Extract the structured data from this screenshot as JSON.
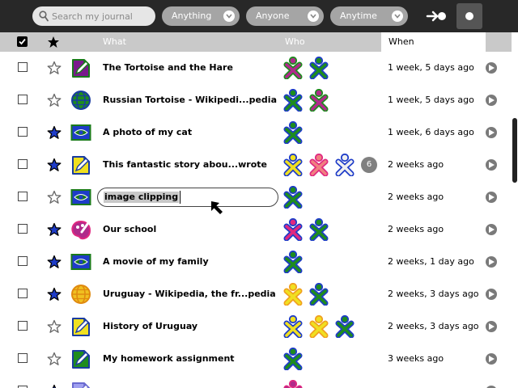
{
  "toolbar": {
    "search_placeholder": "Search my journal",
    "filters": [
      {
        "label": "Anything"
      },
      {
        "label": "Anyone"
      },
      {
        "label": "Anytime"
      }
    ],
    "buttons": [
      "share-arrow-icon",
      "record-icon"
    ]
  },
  "columns": {
    "what": "What",
    "who": "Who",
    "when": "When"
  },
  "entries": [
    {
      "title": "The Tortoise and the Hare",
      "when": "1 week, 5 days ago",
      "starred": false,
      "icon": "write-activity-icon",
      "icon_colors": {
        "stroke": "#1a7a1a",
        "fill": "#7a1a8c"
      },
      "buddies": [
        {
          "stroke": "#1e8c1e",
          "fill": "#b02a8a"
        },
        {
          "stroke": "#1e3cc8",
          "fill": "#1e8c1e"
        }
      ]
    },
    {
      "title": "Russian Tortoise - Wikipedi...pedia",
      "when": "1 week, 5 days ago",
      "starred": false,
      "icon": "browse-activity-icon",
      "icon_colors": {
        "stroke": "#1a3ca0",
        "fill": "#1e8c1e"
      },
      "buddies": [
        {
          "stroke": "#1e3cc8",
          "fill": "#1e8c1e"
        },
        {
          "stroke": "#1e8c1e",
          "fill": "#b02a8a"
        }
      ]
    },
    {
      "title": "A photo of my cat",
      "when": "1 week, 6 days ago",
      "starred": true,
      "icon": "image-viewer-icon",
      "icon_colors": {
        "stroke": "#1a7a1a",
        "fill": "#1e3cc8"
      },
      "buddies": [
        {
          "stroke": "#1e3cc8",
          "fill": "#1e8c1e"
        }
      ]
    },
    {
      "title": "This fantastic story abou...wrote",
      "when": "2 weeks ago",
      "starred": true,
      "icon": "write-activity-icon",
      "icon_colors": {
        "stroke": "#1a3ca0",
        "fill": "#f0e020"
      },
      "buddies": [
        {
          "stroke": "#1e3cc8",
          "fill": "#f0e020"
        },
        {
          "stroke": "#e02880",
          "fill": "#f08080"
        },
        {
          "stroke": "#1e3cc8",
          "fill": "#f0f0f0"
        }
      ],
      "more_buddies": "6"
    },
    {
      "title": "image clipping",
      "when": "2 weeks ago",
      "starred": false,
      "editing": true,
      "icon": "image-viewer-icon",
      "icon_colors": {
        "stroke": "#1a7a1a",
        "fill": "#1e3cc8"
      },
      "buddies": [
        {
          "stroke": "#1e3cc8",
          "fill": "#1e8c1e"
        }
      ]
    },
    {
      "title": "Our school",
      "when": "2 weeks ago",
      "starred": true,
      "icon": "paint-activity-icon",
      "icon_colors": {
        "stroke": "#e02880",
        "fill": "#b02a8a"
      },
      "buddies": [
        {
          "stroke": "#1e3cc8",
          "fill": "#e02880"
        },
        {
          "stroke": "#1e3cc8",
          "fill": "#1e8c1e"
        }
      ]
    },
    {
      "title": "A movie of my family",
      "when": "2 weeks, 1 day ago",
      "starred": true,
      "icon": "image-viewer-icon",
      "icon_colors": {
        "stroke": "#1a7a1a",
        "fill": "#1e3cc8"
      },
      "buddies": [
        {
          "stroke": "#1e3cc8",
          "fill": "#1e8c1e"
        }
      ]
    },
    {
      "title": "Uruguay - Wikipedia, the fr...pedia",
      "when": "2 weeks, 3 days ago",
      "starred": true,
      "icon": "browse-activity-icon",
      "icon_colors": {
        "stroke": "#e08a10",
        "fill": "#f0c020"
      },
      "buddies": [
        {
          "stroke": "#f0a020",
          "fill": "#f0e020"
        },
        {
          "stroke": "#1e3cc8",
          "fill": "#1e8c1e"
        }
      ]
    },
    {
      "title": "History of Uruguay",
      "when": "2 weeks, 3 days ago",
      "starred": false,
      "icon": "write-activity-icon",
      "icon_colors": {
        "stroke": "#1a3ca0",
        "fill": "#f0e020"
      },
      "buddies": [
        {
          "stroke": "#1e3cc8",
          "fill": "#f0e020"
        },
        {
          "stroke": "#f0a020",
          "fill": "#f0e020"
        },
        {
          "stroke": "#1e3cc8",
          "fill": "#1e8c1e"
        }
      ]
    },
    {
      "title": "My homework assignment",
      "when": "3 weeks ago",
      "starred": false,
      "icon": "write-activity-icon",
      "icon_colors": {
        "stroke": "#1a3ca0",
        "fill": "#1e8c1e"
      },
      "buddies": [
        {
          "stroke": "#1e3cc8",
          "fill": "#1e8c1e"
        }
      ]
    },
    {
      "title": "",
      "when": "",
      "starred": true,
      "icon": "write-activity-icon",
      "icon_colors": {
        "stroke": "#6a6ad0",
        "fill": "#a0a0f0"
      },
      "buddies": [
        {
          "stroke": "#e02880",
          "fill": "#b02a8a"
        }
      ]
    }
  ]
}
